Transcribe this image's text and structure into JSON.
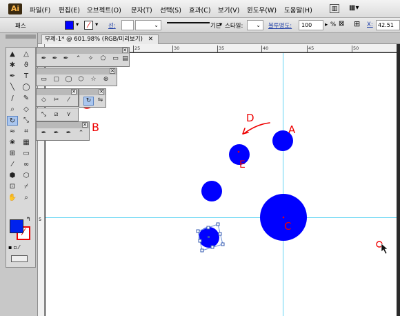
{
  "app": {
    "logo": "Ai"
  },
  "menu": [
    "파일(F)",
    "편집(E)",
    "오브젝트(O)",
    "문자(T)",
    "선택(S)",
    "효과(C)",
    "보기(V)",
    "윈도우(W)",
    "도움말(H)"
  ],
  "control_bar": {
    "path_label": "패스",
    "fill_color": "#0000ff",
    "stroke_label": "선:",
    "stroke_style": "기본",
    "style_label": "스타일:",
    "opacity_label": "불투명도:",
    "opacity_value": "100",
    "opacity_unit": "%",
    "x_label": "X:",
    "x_value": "42.51"
  },
  "document": {
    "tab_title": "무제-1* @ 601.98% (RGB/미리보기)"
  },
  "ruler": {
    "h_ticks": [
      "25",
      "30",
      "35",
      "40",
      "45",
      "50"
    ],
    "v_ticks": [
      "5"
    ]
  },
  "toolbox": {
    "fill_color": "#0022ee",
    "stroke_color": "#ff0000",
    "tools": [
      [
        "select-icon",
        "▲"
      ],
      [
        "direct-select-icon",
        "△"
      ],
      [
        "magic-wand-icon",
        "✱"
      ],
      [
        "lasso-icon",
        "ϑ"
      ],
      [
        "pen-icon",
        "✒"
      ],
      [
        "type-icon",
        "T"
      ],
      [
        "line-icon",
        "╲"
      ],
      [
        "ellipse-icon",
        "◯"
      ],
      [
        "brush-icon",
        "/"
      ],
      [
        "pencil-icon",
        "✎"
      ],
      [
        "blob-brush-icon",
        "⌕"
      ],
      [
        "eraser-icon",
        "◇"
      ],
      [
        "rotate-icon",
        "↻"
      ],
      [
        "scale-icon",
        "⤡"
      ],
      [
        "warp-icon",
        "≈"
      ],
      [
        "free-transform-icon",
        "⌗"
      ],
      [
        "symbol-sprayer-icon",
        "❀"
      ],
      [
        "graph-icon",
        "▦"
      ],
      [
        "mesh-icon",
        "⊞"
      ],
      [
        "gradient-icon",
        "▭"
      ],
      [
        "eyedropper-icon",
        "⁄"
      ],
      [
        "blend-icon",
        "∞"
      ],
      [
        "live-paint-icon",
        "⬢"
      ],
      [
        "live-paint-select-icon",
        "⬡"
      ],
      [
        "artboard-icon",
        "⊡"
      ],
      [
        "slice-icon",
        "⌿"
      ],
      [
        "hand-icon",
        "✋"
      ],
      [
        "zoom-icon",
        "⌕"
      ]
    ]
  },
  "annotations": {
    "A": "A",
    "B": "B",
    "C": "C",
    "D": "D",
    "E": "E"
  },
  "colors": {
    "circle_fill": "#0000ff",
    "guide_line": "#5fd3f3",
    "annotation_red": "#ee0000"
  }
}
